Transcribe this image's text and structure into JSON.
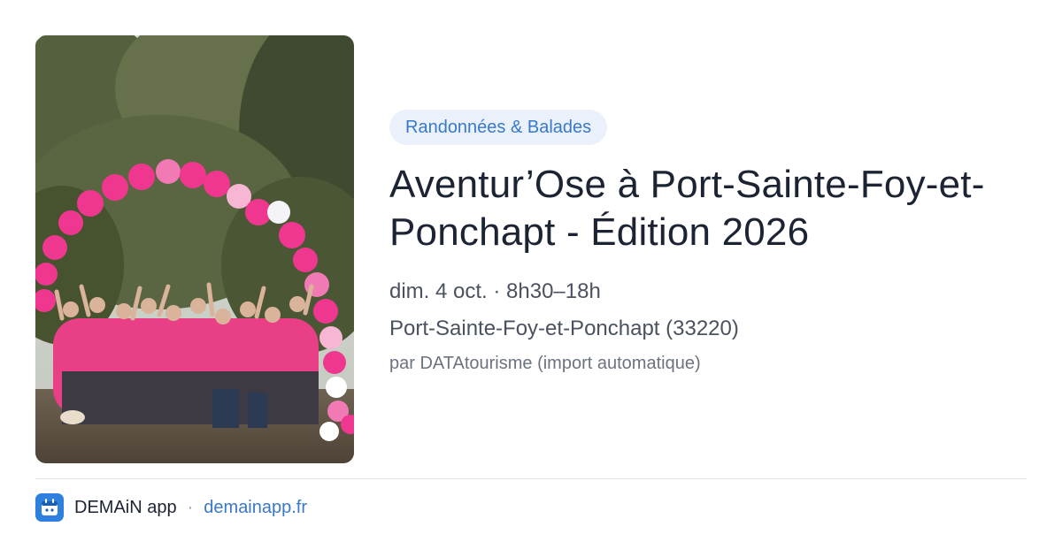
{
  "event": {
    "category": "Randonnées & Balades",
    "title": "Aventur’Ose à Port-Sainte-Foy-et-Ponchapt - Édition 2026",
    "date": "dim. 4 oct. · 8h30–18h",
    "location": "Port-Sainte-Foy-et-Ponchapt (33220)",
    "organizer": "par DATAtourisme (import automatique)"
  },
  "footer": {
    "app_name": "DEMAiN app",
    "separator": "·",
    "domain": "demainapp.fr"
  },
  "colors": {
    "accent": "#3a78c8",
    "pill_bg": "#eaf1fb",
    "app_icon": "#2f7fe0",
    "balloon_pink": "#f0378f"
  },
  "icons": {
    "app": "app-logo-icon"
  }
}
